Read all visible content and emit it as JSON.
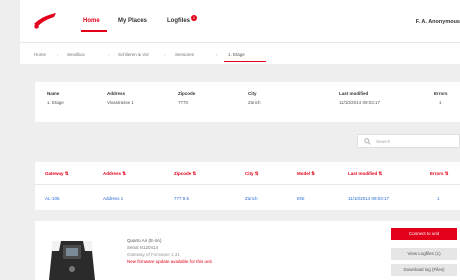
{
  "nav": {
    "home": "Home",
    "places": "My Places",
    "logfiles": "Logfiles",
    "badge": "1",
    "user": "F. A. Anonymous"
  },
  "breadcrumb": [
    "Home",
    "Sendbox",
    "Schlieren & Vol",
    "Sensoren",
    "1. Etage"
  ],
  "summary": {
    "headers": [
      "Name",
      "Address",
      "Zipcode",
      "City",
      "Last modified",
      "Errors"
    ],
    "values": [
      "1. Etage",
      "Vivastrasse 1",
      "7770",
      "Zürich",
      "11/10/2014 09:03:17",
      "1"
    ]
  },
  "search": {
    "placeholder": "Search"
  },
  "table": {
    "headers": [
      "Gateway ⇅",
      "Address ⇅",
      "Zipcode ⇅",
      "City ⇅",
      "Model ⇅",
      "Last modified ⇅",
      "Errors ⇅"
    ],
    "row": [
      "AL-105",
      "Address 1",
      "777 9.5",
      "Zürich",
      "ENI",
      "11/10/2014 09:03:17",
      "1"
    ]
  },
  "detail": {
    "title": "Quarto Air (E-4A)",
    "serial": "Serial N120414",
    "info": "Gateway of Firmware 1.31",
    "alert": "New firmware update available for this unit",
    "buttons": {
      "connect": "Connect to unit",
      "logfile": "View Logfiles (1)",
      "download": "Download log (Files)"
    }
  },
  "colors": {
    "accent": "#e2001a",
    "link": "#2a6bd1"
  }
}
